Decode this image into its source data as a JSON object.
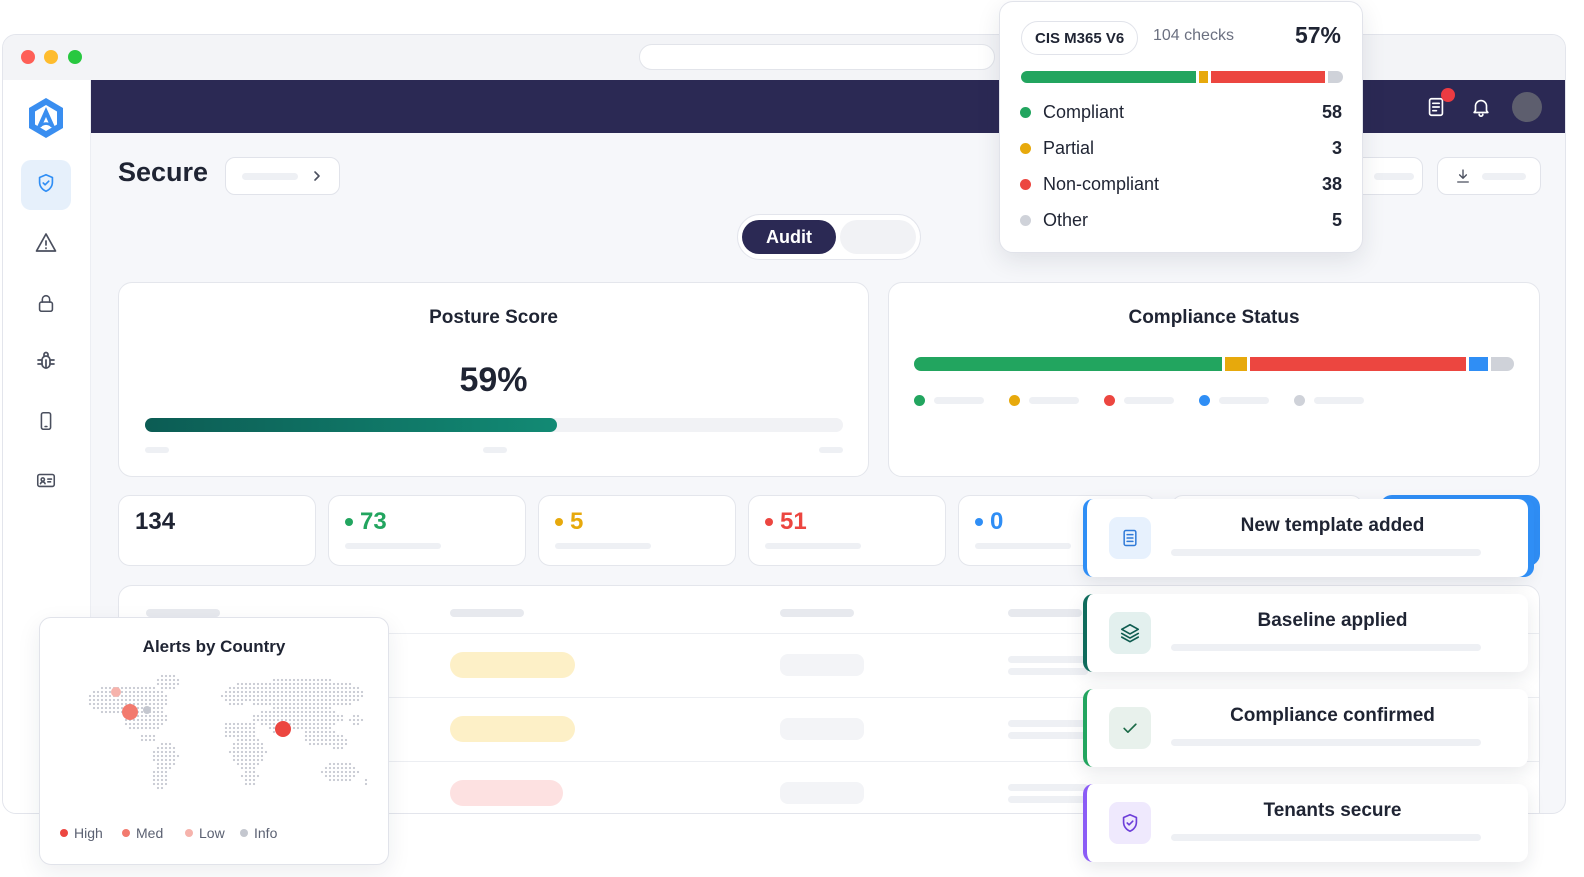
{
  "header": {
    "page_title": "Secure"
  },
  "toggle": {
    "active_label": "Audit"
  },
  "posture": {
    "title": "Posture Score",
    "value_label": "59%",
    "score": 0.59
  },
  "compliance": {
    "title": "Compliance Status",
    "segments": [
      {
        "color": "#22a55f",
        "share": 0.523
      },
      {
        "color": "#e7a90c",
        "share": 0.038
      },
      {
        "color": "#ec4640",
        "share": 0.368
      },
      {
        "color": "#2f8ef5",
        "share": 0.031
      },
      {
        "color": "#cfd2d9",
        "share": 0.04
      }
    ],
    "legend_colors": [
      "#22a55f",
      "#e7a90c",
      "#ec4640",
      "#2f8ef5",
      "#cfd2d9"
    ]
  },
  "stats": [
    {
      "value": "134",
      "color": "#1f2433",
      "dot": false
    },
    {
      "value": "73",
      "color": "#22a55f",
      "dot": true
    },
    {
      "value": "5",
      "color": "#e7a90c",
      "dot": true
    },
    {
      "value": "51",
      "color": "#ec4640",
      "dot": true
    },
    {
      "value": "0",
      "color": "#2f8ef5",
      "dot": true
    }
  ],
  "benchmark": {
    "name": "CIS M365 V6",
    "checks": "104 checks",
    "percent": "57%",
    "items": [
      {
        "label": "Compliant",
        "value": "58",
        "color": "#22a55f"
      },
      {
        "label": "Partial",
        "value": "3",
        "color": "#e7a90c"
      },
      {
        "label": "Non-compliant",
        "value": "38",
        "color": "#ec4640"
      },
      {
        "label": "Other",
        "value": "5",
        "color": "#cfd2d9"
      }
    ]
  },
  "notifications": [
    {
      "title": "New template added",
      "icon": "document-icon",
      "accent": "#2f8ef5",
      "icon_bg": "#e7f1fd",
      "icon_color": "#2f7ad8"
    },
    {
      "title": "Baseline applied",
      "icon": "layers-icon",
      "accent": "#0f6b5c",
      "icon_bg": "#e3f0ee",
      "icon_color": "#0f5c50"
    },
    {
      "title": "Compliance confirmed",
      "icon": "check-icon",
      "accent": "#22a55f",
      "icon_bg": "#e8f1ec",
      "icon_color": "#1c6b48"
    },
    {
      "title": "Tenants secure",
      "icon": "shield-check-icon",
      "accent": "#8b5cf6",
      "icon_bg": "#efe9fd",
      "icon_color": "#6d3fd9"
    }
  ],
  "alerts_map": {
    "title": "Alerts by Country",
    "legend": [
      {
        "label": "High",
        "color": "#ec4640"
      },
      {
        "label": "Med",
        "color": "#f27a6e"
      },
      {
        "label": "Low",
        "color": "#f6b3ac"
      },
      {
        "label": "Info",
        "color": "#c4c7cf"
      }
    ]
  },
  "icons": {
    "logo": "app-logo",
    "sidebar": [
      "shield-icon",
      "warning-icon",
      "lock-icon",
      "bug-icon",
      "mobile-icon",
      "id-card-icon"
    ],
    "topnav": [
      "report-icon",
      "bell-icon",
      "avatar"
    ]
  },
  "theme": {
    "navbar": "#2b2954",
    "accent": "#2f8ef5",
    "teal": "#0f6b5c"
  }
}
